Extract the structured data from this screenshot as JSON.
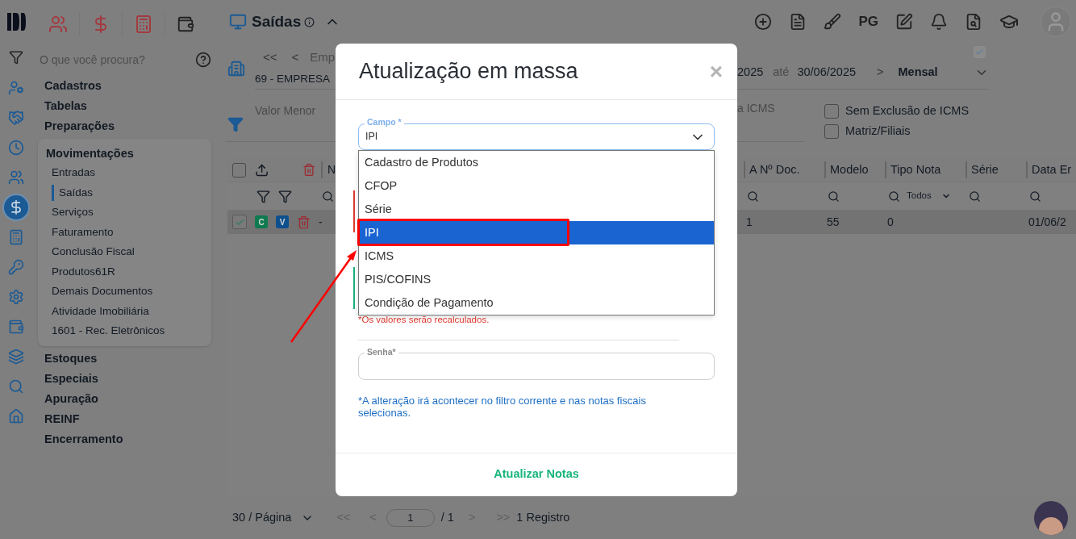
{
  "rail": [
    {
      "selected": false
    },
    {
      "selected": false
    },
    {
      "selected": false
    },
    {
      "selected": false
    },
    {
      "selected": true
    },
    {
      "selected": false
    },
    {
      "selected": false
    },
    {
      "selected": false
    },
    {
      "selected": false
    },
    {
      "selected": false
    },
    {
      "selected": false
    },
    {
      "selected": false
    }
  ],
  "search": {
    "placeholder": "O que você procura?"
  },
  "menu": [
    {
      "label": "Cadastros"
    },
    {
      "label": "Tabelas"
    },
    {
      "label": "Preparações"
    },
    {
      "label": "Movimentações",
      "expanded": true,
      "children": [
        {
          "label": "Entradas",
          "selected": false
        },
        {
          "label": "Saídas",
          "selected": true
        },
        {
          "label": "Serviços",
          "selected": false
        },
        {
          "label": "Faturamento",
          "selected": false
        },
        {
          "label": "Conclusão Fiscal",
          "selected": false
        },
        {
          "label": "Produtos61R",
          "selected": false
        },
        {
          "label": "Demais Documentos",
          "selected": false
        },
        {
          "label": "Atividade Imobiliária",
          "selected": false
        },
        {
          "label": "1601 - Rec. Eletrônicos",
          "selected": false
        }
      ]
    },
    {
      "label": "Estoques"
    },
    {
      "label": "Especiais"
    },
    {
      "label": "Apuração"
    },
    {
      "label": "REINF"
    },
    {
      "label": "Encerramento"
    }
  ],
  "page": {
    "title": "Saídas",
    "pg_label": "PG"
  },
  "filters": {
    "nav_first": "<<",
    "nav_prev": "<",
    "company_label": "Emp",
    "company": "69 - EMPRESA",
    "date_from": "2025",
    "date_sep": "até",
    "date_to": "30/06/2025",
    "nav_next": ">",
    "period": "Mensal",
    "period_checked": true,
    "value_label": "Valor Menor",
    "value2_label": "a ICMS",
    "options": [
      {
        "label": "Sem Exclusão de ICMS",
        "checked": false
      },
      {
        "label": "Matriz/Filiais",
        "checked": false
      }
    ]
  },
  "table": {
    "select_all_checked": false,
    "column_1": "N",
    "columns": [
      {
        "label": "A Nº Doc.",
        "cell": "1"
      },
      {
        "label": "Modelo",
        "cell": "55"
      },
      {
        "label": "Tipo Nota",
        "cell": "0",
        "filter": "Todos"
      },
      {
        "label": "Série"
      },
      {
        "label": "Data Er",
        "cell": "01/06/2"
      }
    ],
    "row": {
      "checked": true,
      "badges": [
        {
          "text": "C",
          "color": "#0f7a4f"
        },
        {
          "text": "V",
          "color": "#0e4f8e"
        }
      ],
      "cell_1": "-"
    }
  },
  "pagination": {
    "page_size": "30 / Página",
    "first": "<<",
    "prev": "<",
    "page": "1",
    "total": "/ 1",
    "next": ">",
    "last": ">>",
    "count": "1 Registro"
  },
  "modal": {
    "title": "Atualização em massa",
    "close": "×",
    "field": {
      "label": "Campo *",
      "value": "IPI"
    },
    "options": [
      {
        "label": "Cadastro de Produtos",
        "selected": false,
        "boxed": false
      },
      {
        "label": "CFOP",
        "selected": false,
        "boxed": false
      },
      {
        "label": "Série",
        "selected": false,
        "boxed": false
      },
      {
        "label": "IPI",
        "selected": true,
        "boxed": true
      },
      {
        "label": "ICMS",
        "selected": false,
        "boxed": false
      },
      {
        "label": "PIS/COFINS",
        "selected": false,
        "boxed": false
      },
      {
        "label": "Condição de Pagamento",
        "selected": false,
        "boxed": false
      }
    ],
    "warning": "*Os valores serão recalculados.",
    "password": {
      "label": "Senha*"
    },
    "note": "*A alteração irá acontecer no filtro corrente e nas notas fiscais selecionas.",
    "submit": "Atualizar Notas"
  }
}
